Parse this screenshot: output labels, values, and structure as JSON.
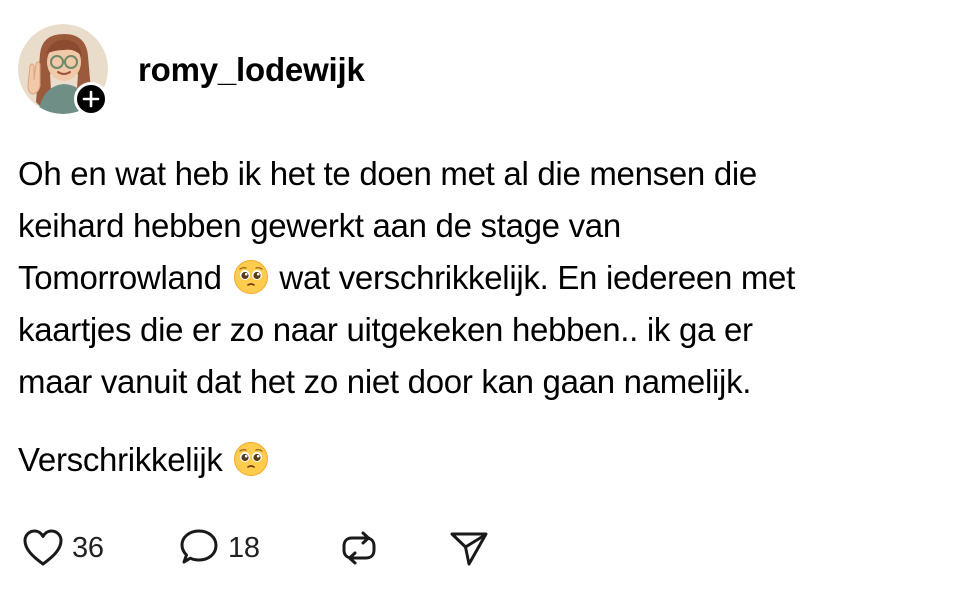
{
  "post": {
    "author": {
      "username": "romy_lodewijk",
      "avatar_icon": "avatar-illustration-woman-peace-sign",
      "follow_icon": "plus-icon"
    },
    "text": {
      "line1": "Oh en wat heb ik het te doen met al die mensen die",
      "line2": "keihard hebben gewerkt aan de stage van",
      "line3_before_emoji": "Tomorrowland",
      "line3_after_emoji": "wat verschrikkelijk. En iedereen met",
      "line4": "kaartjes die er zo naar uitgekeken hebben.. ik ga er",
      "line5": "maar vanuit dat het zo niet door kan gaan namelijk.",
      "para2": "Verschrikkelijk",
      "emoji": "pleading-face-emoji"
    },
    "actions": {
      "like": {
        "icon": "heart-icon",
        "count": "36"
      },
      "reply": {
        "icon": "comment-bubble-icon",
        "count": "18"
      },
      "repost": {
        "icon": "repost-icon"
      },
      "share": {
        "icon": "send-icon"
      }
    }
  }
}
